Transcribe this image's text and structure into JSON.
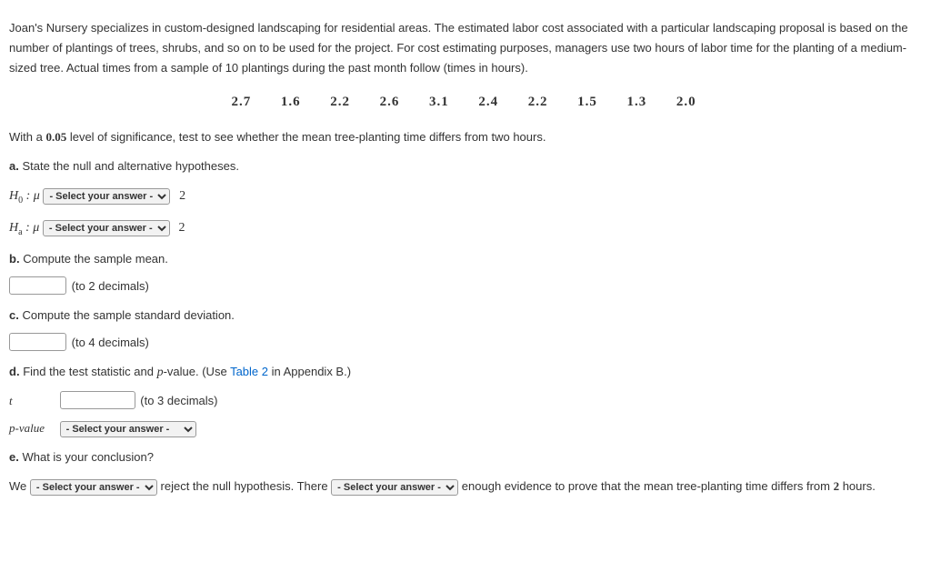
{
  "intro": "Joan's Nursery specializes in custom-designed landscaping for residential areas. The estimated labor cost associated with a particular landscaping proposal is based on the number of plantings of trees, shrubs, and so on to be used for the project. For cost estimating purposes, managers use two hours of labor time for the planting of a medium-sized tree. Actual times from a sample of 10 plantings during the past month follow (times in hours).",
  "data": [
    "2.7",
    "1.6",
    "2.2",
    "2.6",
    "3.1",
    "2.4",
    "2.2",
    "1.5",
    "1.3",
    "2.0"
  ],
  "sig_line_pre": "With a ",
  "sig_value": "0.05",
  "sig_line_post": " level of significance, test to see whether the mean tree-planting time differs from two hours.",
  "parts": {
    "a": {
      "label": "a.",
      "text": "State the null and alternative hypotheses."
    },
    "b": {
      "label": "b.",
      "text": "Compute the sample mean."
    },
    "c": {
      "label": "c.",
      "text": "Compute the sample standard deviation."
    },
    "d": {
      "label": "d.",
      "text_pre": "Find the test statistic and ",
      "text_mid": "p",
      "text_post": "-value. (Use ",
      "link": "Table 2",
      "text_end": " in Appendix B.)"
    },
    "e": {
      "label": "e.",
      "text": "What is your conclusion?"
    }
  },
  "hyp": {
    "H0_pre": "H",
    "H0_sub": "0",
    "Ha_pre": "H",
    "Ha_sub": "a",
    "mu": "μ",
    "colon": " : ",
    "value": "2"
  },
  "select_placeholder": "- Select your answer -",
  "hints": {
    "b": "(to 2 decimals)",
    "c": "(to 4 decimals)",
    "t": "(to 3 decimals)"
  },
  "d_labels": {
    "t": "t",
    "p": "p-value"
  },
  "conclusion": {
    "we": "We ",
    "mid1": " reject the null hypothesis. There ",
    "mid2": " enough evidence to prove that the mean tree-planting time differs from ",
    "val": "2",
    "end": " hours."
  }
}
